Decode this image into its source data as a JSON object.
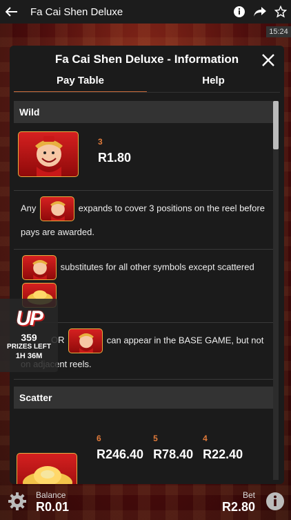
{
  "appbar": {
    "title": "Fa Cai Shen Deluxe"
  },
  "clock": "15:24",
  "modal": {
    "title": "Fa Cai Shen Deluxe - Information",
    "tabs": [
      "Pay Table",
      "Help"
    ]
  },
  "wild": {
    "header": "Wild",
    "pay": {
      "count": "3",
      "value": "R1.80"
    },
    "text1_before": "Any",
    "text1_after": "expands to cover 3 positions on the reel before pays are awarded.",
    "text2_after": "substitutes for all other symbols except scattered",
    "text3_before": "OR",
    "text3_after": "can appear in the BASE GAME, but not on adjacent reels."
  },
  "scatter": {
    "header": "Scatter",
    "pays": [
      {
        "count": "6",
        "value": "R246.40"
      },
      {
        "count": "5",
        "value": "R78.40"
      },
      {
        "count": "4",
        "value": "R22.40"
      }
    ]
  },
  "promo": {
    "logo": "UP",
    "count": "359",
    "label": "PRIZES LEFT",
    "time": "1H 36M"
  },
  "bottom": {
    "balance_label": "Balance",
    "balance_value": "R0.01",
    "bet_label": "Bet",
    "bet_value": "R2.80"
  },
  "colors": {
    "accent": "#e07a3a",
    "modal_bg": "#1b1b1b",
    "section_bg": "#333333",
    "symbol_red": "#d52020",
    "symbol_gold": "#e8b040"
  }
}
